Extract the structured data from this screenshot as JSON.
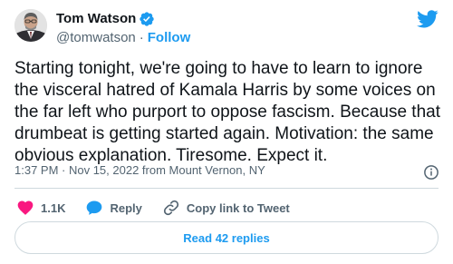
{
  "author": {
    "name": "Tom Watson",
    "handle": "@tomwatson",
    "separator": "·",
    "follow_label": "Follow",
    "avatar_icon": "avatar-photo",
    "verified_icon": "verified-badge-icon"
  },
  "tweet": {
    "text": "Starting tonight, we're going to have to learn to ignore the visceral hatred of Kamala Harris by some voices on the far left who purport to oppose fascism. Because that drumbeat is getting started again. Motivation: the same obvious explanation. Tiresome. Expect it.",
    "timestamp": "1:37 PM · Nov 15, 2022 from Mount Vernon, NY"
  },
  "actions": {
    "like_count": "1.1K",
    "reply_label": "Reply",
    "copy_label": "Copy link to Tweet"
  },
  "replies_button": "Read 42 replies",
  "colors": {
    "accent": "#1d9bf0",
    "like": "#f91880",
    "muted": "#536471",
    "border": "#cfd9de"
  }
}
